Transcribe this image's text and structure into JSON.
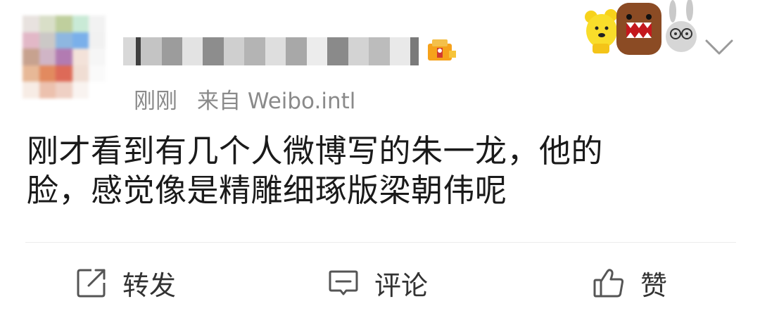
{
  "post": {
    "meta_time": "刚刚",
    "meta_source": "来自 Weibo.intl",
    "text_line1": "刚才看到有几个人微博写的朱一龙，他的",
    "text_line2": "脸，感觉像是精雕细琢版梁朝伟呢"
  },
  "actions": {
    "repost_label": "转发",
    "comment_label": "评论",
    "like_label": "赞"
  },
  "icons": {
    "repost": "share-square-icon",
    "comment": "comment-bubble-icon",
    "like": "thumbs-up-icon",
    "more": "chevron-down-icon",
    "vip": "vip-badge-icon"
  },
  "colors": {
    "meta_text": "#8a8a8a",
    "content_text": "#1a1a1a",
    "icon_stroke": "#555555"
  }
}
